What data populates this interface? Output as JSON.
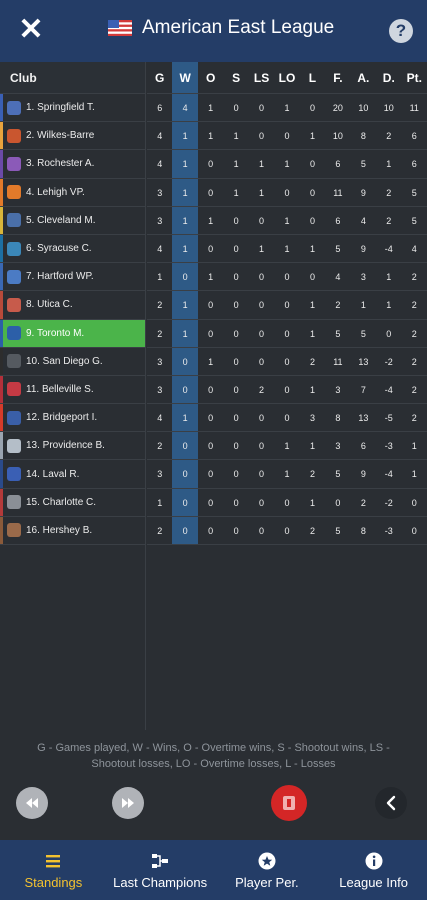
{
  "header": {
    "title": "American East League"
  },
  "table": {
    "columns": [
      "Club",
      "G",
      "W",
      "O",
      "S",
      "LS",
      "LO",
      "L",
      "F.",
      "A.",
      "D.",
      "Pt."
    ],
    "rows": [
      {
        "club": "1. Springfield T.",
        "color": "#3a5fb4",
        "logo": "#4d6fb8",
        "stats": [
          "6",
          "4",
          "1",
          "0",
          "0",
          "1",
          "0",
          "20",
          "10",
          "10",
          "11"
        ]
      },
      {
        "club": "2. Wilkes-Barre",
        "color": "#e8a33d",
        "logo": "#c9562f",
        "stats": [
          "4",
          "1",
          "1",
          "1",
          "0",
          "0",
          "1",
          "10",
          "8",
          "2",
          "6"
        ]
      },
      {
        "club": "3. Rochester A.",
        "color": "#6b4aa8",
        "logo": "#8b5ab8",
        "stats": [
          "4",
          "1",
          "0",
          "1",
          "1",
          "1",
          "0",
          "6",
          "5",
          "1",
          "6"
        ]
      },
      {
        "club": "4. Lehigh VP.",
        "color": "#e27a2a",
        "logo": "#e27a2a",
        "stats": [
          "3",
          "1",
          "0",
          "1",
          "1",
          "0",
          "0",
          "11",
          "9",
          "2",
          "5"
        ]
      },
      {
        "club": "5. Cleveland M.",
        "color": "#d8b53a",
        "logo": "#4a6fa8",
        "stats": [
          "3",
          "1",
          "1",
          "0",
          "0",
          "1",
          "0",
          "6",
          "4",
          "2",
          "5"
        ]
      },
      {
        "club": "6. Syracuse C.",
        "color": "#1d6fa3",
        "logo": "#3b87b8",
        "stats": [
          "4",
          "1",
          "0",
          "0",
          "1",
          "1",
          "1",
          "5",
          "9",
          "-4",
          "4"
        ]
      },
      {
        "club": "7. Hartford WP.",
        "color": "#3a68b3",
        "logo": "#4b7bc4",
        "stats": [
          "1",
          "0",
          "1",
          "0",
          "0",
          "0",
          "0",
          "4",
          "3",
          "1",
          "2"
        ]
      },
      {
        "club": "8. Utica C.",
        "color": "#b84a3a",
        "logo": "#c75b4b",
        "stats": [
          "2",
          "1",
          "0",
          "0",
          "0",
          "0",
          "1",
          "2",
          "1",
          "1",
          "2"
        ]
      },
      {
        "club": "9. Toronto M.",
        "color": "#2c5fa8",
        "logo": "#2c5fa8",
        "stats": [
          "2",
          "1",
          "0",
          "0",
          "0",
          "0",
          "1",
          "5",
          "5",
          "0",
          "2"
        ]
      },
      {
        "club": "10. San Diego G.",
        "color": "#2d2d2d",
        "logo": "#555a60",
        "stats": [
          "3",
          "0",
          "1",
          "0",
          "0",
          "0",
          "2",
          "11",
          "13",
          "-2",
          "2"
        ]
      },
      {
        "club": "11. Belleville S.",
        "color": "#b3303a",
        "logo": "#c53a44",
        "stats": [
          "3",
          "0",
          "0",
          "0",
          "2",
          "0",
          "1",
          "3",
          "7",
          "-4",
          "2"
        ]
      },
      {
        "club": "12. Bridgeport I.",
        "color": "#d43b2a",
        "logo": "#3a5fa8",
        "stats": [
          "4",
          "1",
          "0",
          "0",
          "0",
          "0",
          "3",
          "8",
          "13",
          "-5",
          "2"
        ]
      },
      {
        "club": "13. Providence B.",
        "color": "#9aa4b0",
        "logo": "#b4bec8",
        "stats": [
          "2",
          "0",
          "0",
          "0",
          "0",
          "1",
          "1",
          "3",
          "6",
          "-3",
          "1"
        ]
      },
      {
        "club": "14. Laval R.",
        "color": "#2a4a8a",
        "logo": "#3a5fb4",
        "stats": [
          "3",
          "0",
          "0",
          "0",
          "0",
          "1",
          "2",
          "5",
          "9",
          "-4",
          "1"
        ]
      },
      {
        "club": "15. Charlotte C.",
        "color": "#b33a3a",
        "logo": "#8a8f96",
        "stats": [
          "1",
          "0",
          "0",
          "0",
          "0",
          "0",
          "1",
          "0",
          "2",
          "-2",
          "0"
        ]
      },
      {
        "club": "16. Hershey B.",
        "color": "#8a5a3a",
        "logo": "#9a6a4a",
        "stats": [
          "2",
          "0",
          "0",
          "0",
          "0",
          "0",
          "2",
          "5",
          "8",
          "-3",
          "0"
        ]
      }
    ],
    "highlight_index": 8
  },
  "legend": "G - Games played, W - Wins, O - Overtime wins, S - Shootout wins, LS - Shootout losses, LO - Overtime losses, L - Losses",
  "nav": [
    {
      "label": "Standings",
      "icon": "list-icon"
    },
    {
      "label": "Last Champions",
      "icon": "tree-icon"
    },
    {
      "label": "Player Per.",
      "icon": "star-badge-icon"
    },
    {
      "label": "League Info",
      "icon": "info-icon"
    }
  ],
  "colors": {
    "header": "#243d67",
    "accent": "#f3c230",
    "highlight": "#4bb44a",
    "wcol": "#2e5a86"
  }
}
